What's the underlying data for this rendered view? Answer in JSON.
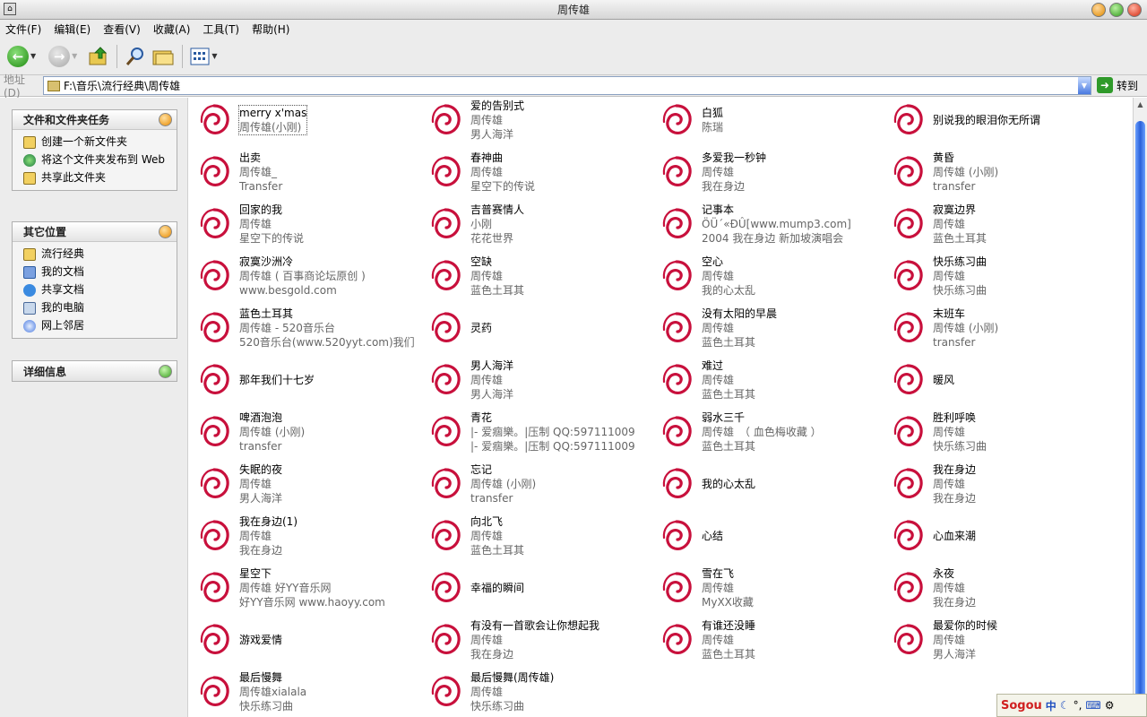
{
  "window": {
    "title": "周传雄"
  },
  "menu": [
    "文件(F)",
    "编辑(E)",
    "查看(V)",
    "收藏(A)",
    "工具(T)",
    "帮助(H)"
  ],
  "address": {
    "label": "地址(D)",
    "path": "F:\\音乐\\流行经典\\周传雄",
    "go": "转到"
  },
  "tasks": {
    "title": "文件和文件夹任务",
    "items": [
      {
        "label": "创建一个新文件夹",
        "icon": "new-folder-icon"
      },
      {
        "label": "将这个文件夹发布到 Web",
        "icon": "publish-web-icon"
      },
      {
        "label": "共享此文件夹",
        "icon": "share-folder-icon"
      }
    ]
  },
  "places": {
    "title": "其它位置",
    "items": [
      {
        "label": "流行经典",
        "icon": "folder-icon"
      },
      {
        "label": "我的文档",
        "icon": "documents-icon"
      },
      {
        "label": "共享文档",
        "icon": "shared-docs-icon"
      },
      {
        "label": "我的电脑",
        "icon": "computer-icon"
      },
      {
        "label": "网上邻居",
        "icon": "network-icon"
      }
    ]
  },
  "details": {
    "title": "详细信息"
  },
  "files": [
    {
      "t": "merry x'mas",
      "a": "周传雄(小刚)",
      "b": ""
    },
    {
      "t": "爱的告别式",
      "a": "周传雄",
      "b": "男人海洋"
    },
    {
      "t": "白狐",
      "a": "陈瑞",
      "b": ""
    },
    {
      "t": "别说我的眼泪你无所谓",
      "a": "",
      "b": ""
    },
    {
      "t": "出卖",
      "a": "周传雄_",
      "b": "Transfer"
    },
    {
      "t": "春神曲",
      "a": "周传雄",
      "b": "星空下的传说"
    },
    {
      "t": "多爱我一秒钟",
      "a": "周传雄",
      "b": "我在身边"
    },
    {
      "t": "黄昏",
      "a": "周传雄 (小刚)",
      "b": "transfer"
    },
    {
      "t": "回家的我",
      "a": "周传雄",
      "b": "星空下的传说"
    },
    {
      "t": "吉普赛情人",
      "a": "小刚",
      "b": "花花世界"
    },
    {
      "t": "记事本",
      "a": "ÖÜ´«ÐÛ[www.mump3.com]",
      "b": "2004 我在身边 新加坡演唱会"
    },
    {
      "t": "寂寞边界",
      "a": "周传雄",
      "b": "蓝色土耳其"
    },
    {
      "t": "寂寞沙洲冷",
      "a": "周传雄 ( 百事商论坛原创 )",
      "b": "www.besgold.com"
    },
    {
      "t": "空缺",
      "a": "周传雄",
      "b": "蓝色土耳其"
    },
    {
      "t": "空心",
      "a": "周传雄",
      "b": "我的心太乱"
    },
    {
      "t": "快乐练习曲",
      "a": "周传雄",
      "b": "快乐练习曲"
    },
    {
      "t": "蓝色土耳其",
      "a": "周传雄 - 520音乐台",
      "b": "520音乐台(www.520yyt.com)我们"
    },
    {
      "t": "灵药",
      "a": "",
      "b": ""
    },
    {
      "t": "没有太阳的早晨",
      "a": "周传雄",
      "b": "蓝色土耳其"
    },
    {
      "t": "末班车",
      "a": "周传雄 (小刚)",
      "b": "transfer"
    },
    {
      "t": "那年我们十七岁",
      "a": "",
      "b": ""
    },
    {
      "t": "男人海洋",
      "a": "周传雄",
      "b": "男人海洋"
    },
    {
      "t": "难过",
      "a": "周传雄",
      "b": "蓝色土耳其"
    },
    {
      "t": "暖风",
      "a": "",
      "b": ""
    },
    {
      "t": "啤酒泡泡",
      "a": "周传雄 (小刚)",
      "b": "transfer"
    },
    {
      "t": "青花",
      "a": "|- 爱痼樂。|压制 QQ:597111009",
      "b": "|- 爱痼樂。|压制 QQ:597111009"
    },
    {
      "t": "弱水三千",
      "a": "周传雄　（ 血色梅收藏 ）",
      "b": "蓝色土耳其"
    },
    {
      "t": "胜利呼唤",
      "a": "周传雄",
      "b": "快乐练习曲"
    },
    {
      "t": "失眠的夜",
      "a": "周传雄",
      "b": "男人海洋"
    },
    {
      "t": "忘记",
      "a": "周传雄 (小刚)",
      "b": "transfer"
    },
    {
      "t": "我的心太乱",
      "a": "",
      "b": ""
    },
    {
      "t": "我在身边",
      "a": "周传雄",
      "b": "我在身边"
    },
    {
      "t": "我在身边(1)",
      "a": "周传雄",
      "b": "我在身边"
    },
    {
      "t": "向北飞",
      "a": "周传雄",
      "b": "蓝色土耳其"
    },
    {
      "t": "心结",
      "a": "",
      "b": ""
    },
    {
      "t": "心血来潮",
      "a": "",
      "b": ""
    },
    {
      "t": "星空下",
      "a": "周传雄 好YY音乐网",
      "b": "好YY音乐网 www.haoyy.com"
    },
    {
      "t": "幸福的瞬间",
      "a": "",
      "b": ""
    },
    {
      "t": "雪在飞",
      "a": "周传雄",
      "b": "MyXX收藏"
    },
    {
      "t": "永夜",
      "a": "周传雄",
      "b": "我在身边"
    },
    {
      "t": "游戏爱情",
      "a": "",
      "b": ""
    },
    {
      "t": "有没有一首歌会让你想起我",
      "a": "周传雄",
      "b": "我在身边"
    },
    {
      "t": "有谁还没睡",
      "a": "周传雄",
      "b": "蓝色土耳其"
    },
    {
      "t": "最爱你的时候",
      "a": "周传雄",
      "b": "男人海洋"
    },
    {
      "t": "最后慢舞",
      "a": "周传雄xialala",
      "b": "快乐练习曲"
    },
    {
      "t": "最后慢舞(周传雄)",
      "a": "周传雄",
      "b": "快乐练习曲"
    }
  ],
  "ime": {
    "brand": "Sogou",
    "mode": "中"
  }
}
